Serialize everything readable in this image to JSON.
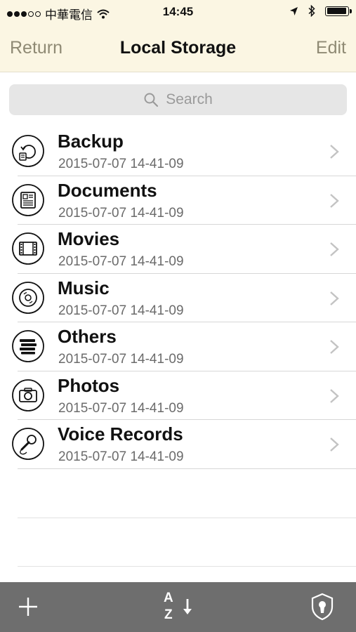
{
  "status_bar": {
    "carrier": "中華電信",
    "time": "14:45",
    "icons": [
      "signal-dots-icon",
      "wifi-icon",
      "location-arrow-icon",
      "bluetooth-icon",
      "battery-icon"
    ],
    "battery_level": 0.95
  },
  "nav": {
    "return_label": "Return",
    "title": "Local Storage",
    "edit_label": "Edit"
  },
  "search": {
    "placeholder": "Search"
  },
  "folders": [
    {
      "name": "Backup",
      "date": "2015-07-07 14-41-09",
      "icon": "backup-icon"
    },
    {
      "name": "Documents",
      "date": "2015-07-07 14-41-09",
      "icon": "document-icon"
    },
    {
      "name": "Movies",
      "date": "2015-07-07 14-41-09",
      "icon": "film-icon"
    },
    {
      "name": "Music",
      "date": "2015-07-07 14-41-09",
      "icon": "disc-icon"
    },
    {
      "name": "Others",
      "date": "2015-07-07 14-41-09",
      "icon": "stack-icon"
    },
    {
      "name": "Photos",
      "date": "2015-07-07 14-41-09",
      "icon": "camera-icon"
    },
    {
      "name": "Voice Records",
      "date": "2015-07-07 14-41-09",
      "icon": "microphone-icon"
    }
  ],
  "toolbar": {
    "add_icon": "plus-icon",
    "sort_icon": "sort-az-icon",
    "sort_letters": [
      "A",
      "Z"
    ],
    "lock_icon": "keyhole-shield-icon"
  },
  "colors": {
    "bar_background": "#fbf6e3",
    "nav_button": "#8f8a74",
    "toolbar_background": "#6e6e6e"
  }
}
